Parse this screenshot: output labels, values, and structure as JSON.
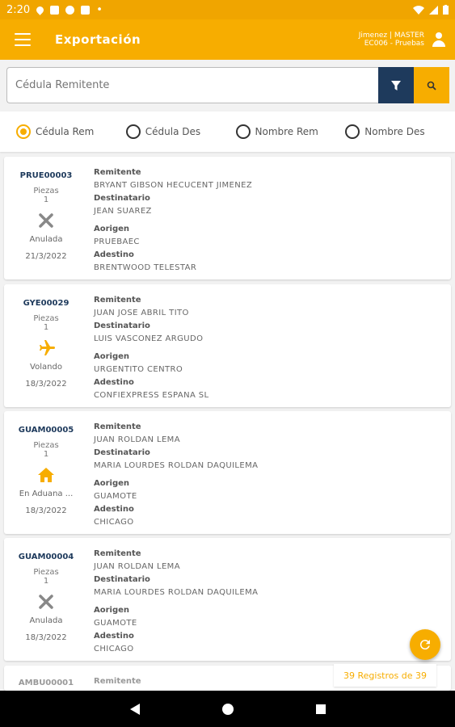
{
  "status_bar": {
    "time": "2:20",
    "dot": "•"
  },
  "app_bar": {
    "title": "Exportación",
    "user_line1": "Jimenez | MASTER",
    "user_line2": "EC006 - Pruebas"
  },
  "search": {
    "placeholder": "Cédula Remitente"
  },
  "radios": [
    {
      "label": "Cédula Rem",
      "selected": true
    },
    {
      "label": "Cédula Des",
      "selected": false
    },
    {
      "label": "Nombre Rem",
      "selected": false
    },
    {
      "label": "Nombre Des",
      "selected": false
    }
  ],
  "labels": {
    "piezas": "Piezas",
    "remitente": "Remitente",
    "destinatario": "Destinatario",
    "aorigen": "Aorigen",
    "adestino": "Adestino"
  },
  "cards": [
    {
      "code": "PRUE00003",
      "piezas": "1",
      "status": "Anulada",
      "status_icon": "cancel-icon",
      "date": "21/3/2022",
      "remitente": "BRYANT GIBSON HECUCENT JIMENEZ",
      "destinatario": "JEAN SUAREZ",
      "aorigen": "PRUEBAEC",
      "adestino": "BRENTWOOD  TELESTAR"
    },
    {
      "code": "GYE00029",
      "piezas": "1",
      "status": "Volando",
      "status_icon": "airplane-icon",
      "date": "18/3/2022",
      "remitente": "JUAN JOSE ABRIL TITO",
      "destinatario": "LUIS VASCONEZ ARGUDO",
      "aorigen": "URGENTITO CENTRO",
      "adestino": "CONFIEXPRESS ESPANA SL"
    },
    {
      "code": "GUAM00005",
      "piezas": "1",
      "status": "En Aduana ...",
      "status_icon": "home-icon",
      "date": "18/3/2022",
      "remitente": "JUAN ROLDAN LEMA",
      "destinatario": "MARIA LOURDES ROLDAN DAQUILEMA",
      "aorigen": "GUAMOTE",
      "adestino": "CHICAGO"
    },
    {
      "code": "GUAM00004",
      "piezas": "1",
      "status": "Anulada",
      "status_icon": "cancel-icon",
      "date": "18/3/2022",
      "remitente": "JUAN ROLDAN LEMA",
      "destinatario": "MARIA LOURDES ROLDAN DAQUILEMA",
      "aorigen": "GUAMOTE",
      "adestino": "CHICAGO"
    },
    {
      "code": "AMBU00001",
      "remitente": "Remitente"
    }
  ],
  "counter": "39 Registros de 39",
  "colors": {
    "accent": "#f7ad00",
    "navy": "#1e3a5c"
  }
}
